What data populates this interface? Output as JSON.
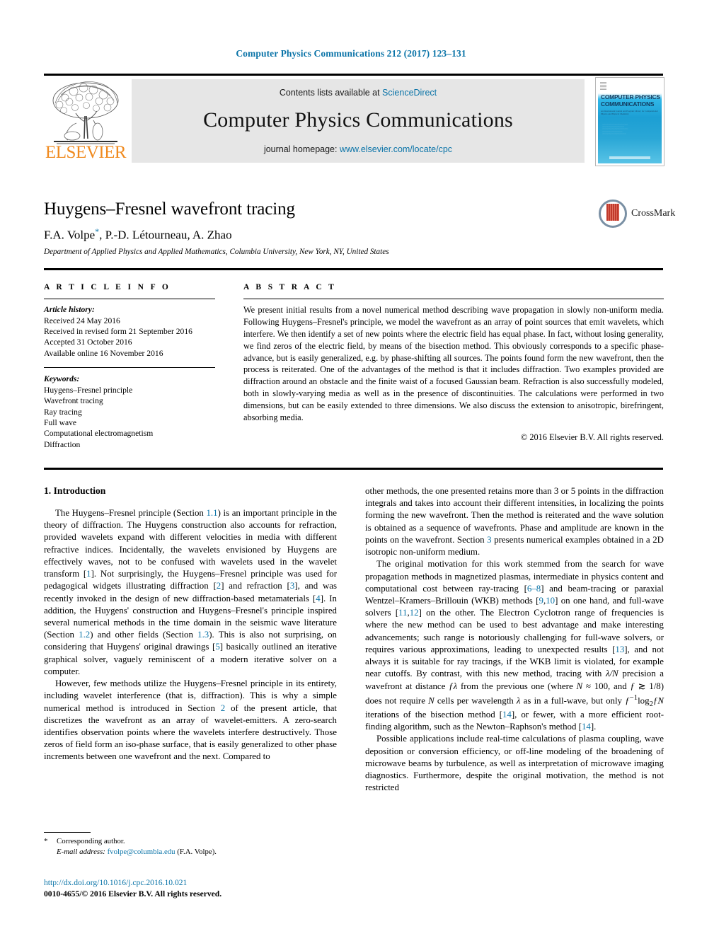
{
  "running_head": "Computer Physics Communications 212 (2017) 123–131",
  "masthead": {
    "contents_prefix": "Contents lists available at ",
    "contents_link": "ScienceDirect",
    "journal_title": "Computer Physics Communications",
    "homepage_prefix": "journal homepage: ",
    "homepage_link": "www.elsevier.com/locate/cpc",
    "publisher_wordmark": "ELSEVIER",
    "publisher_logo_icon": "elsevier-tree-icon"
  },
  "cover": {
    "title_line1": "COMPUTER PHYSICS",
    "title_line2": "COMMUNICATIONS",
    "subtitle": "An International Journal and Program Library for Computational Physics and Physical Chemistry"
  },
  "article": {
    "title": "Huygens–Fresnel wavefront tracing",
    "authors": "F.A. Volpe",
    "authors_rest": ", P.-D. Létourneau, A. Zhao",
    "corresponding_marker": "*",
    "affiliation": "Department of Applied Physics and Applied Mathematics, Columbia University, New York, NY, United States",
    "crossmark_label": "CrossMark",
    "crossmark_icon": "crossmark-icon"
  },
  "info": {
    "label": "A R T I C L E    I N F O",
    "history_heading": "Article history:",
    "history": [
      "Received 24 May 2016",
      "Received in revised form 21 September 2016",
      "Accepted 31 October 2016",
      "Available online 16 November 2016"
    ],
    "keywords_heading": "Keywords:",
    "keywords": [
      "Huygens–Fresnel principle",
      "Wavefront tracing",
      "Ray tracing",
      "Full wave",
      "Computational electromagnetism",
      "Diffraction"
    ]
  },
  "abstract": {
    "label": "A B S T R A C T",
    "text": "We present initial results from a novel numerical method describing wave propagation in slowly non-uniform media. Following Huygens–Fresnel's principle, we model the wavefront as an array of point sources that emit wavelets, which interfere. We then identify a set of new points where the electric field has equal phase. In fact, without losing generality, we find zeros of the electric field, by means of the bisection method. This obviously corresponds to a specific phase-advance, but is easily generalized, e.g. by phase-shifting all sources. The points found form the new wavefront, then the process is reiterated. One of the advantages of the method is that it includes diffraction. Two examples provided are diffraction around an obstacle and the finite waist of a focused Gaussian beam. Refraction is also successfully modeled, both in slowly-varying media as well as in the presence of discontinuities. The calculations were performed in two dimensions, but can be easily extended to three dimensions. We also discuss the extension to anisotropic, birefringent, absorbing media.",
    "copyright": "© 2016 Elsevier B.V. All rights reserved."
  },
  "body": {
    "section_heading": "1. Introduction",
    "left_paragraph_1_a": "The Huygens–Fresnel principle (Section ",
    "left_p1_ref1": "1.1",
    "left_paragraph_1_b": ") is an important principle in the theory of diffraction. The Huygens construction also accounts for refraction, provided wavelets expand with different velocities in media with different refractive indices. Incidentally, the wavelets envisioned by Huygens are effectively waves, not to be confused with wavelets used in the wavelet transform [",
    "left_p1_ref2": "1",
    "left_paragraph_1_c": "]. Not surprisingly, the Huygens–Fresnel principle was used for pedagogical widgets illustrating diffraction [",
    "left_p1_ref3": "2",
    "left_paragraph_1_d": "] and refraction [",
    "left_p1_ref4": "3",
    "left_paragraph_1_e": "], and was recently invoked in the design of new diffraction-based metamaterials [",
    "left_p1_ref5": "4",
    "left_paragraph_1_f": "]. In addition, the Huygens' construction and Huygens–Fresnel's principle inspired several numerical methods in the time domain in the seismic wave literature (Section ",
    "left_p1_ref6": "1.2",
    "left_paragraph_1_g": ") and other fields (Section ",
    "left_p1_ref7": "1.3",
    "left_paragraph_1_h": "). This is also not surprising, on considering that Huygens' original drawings [",
    "left_p1_ref8": "5",
    "left_paragraph_1_i": "] basically outlined an iterative graphical solver, vaguely reminiscent of a modern iterative solver on a computer.",
    "left_paragraph_2_a": "However, few methods utilize the Huygens–Fresnel principle in its entirety, including wavelet interference (that is, diffraction). This is why a simple numerical method is introduced in Section ",
    "left_p2_ref1": "2",
    "left_paragraph_2_b": " of the present article, that discretizes the wavefront as an array of wavelet-emitters. A zero-search identifies observation points where the wavelets interfere destructively. Those zeros of field form an iso-phase surface, that is easily generalized to other phase increments between one wavefront and the next. Compared to",
    "right_paragraph_1_a": "other methods, the one presented retains more than 3 or 5 points in the diffraction integrals and takes into account their different intensities, in localizing the points forming the new wavefront. Then the method is reiterated and the wave solution is obtained as a sequence of wavefronts. Phase and amplitude are known in the points on the wavefront. Section ",
    "right_p1_ref1": "3",
    "right_paragraph_1_b": " presents numerical examples obtained in a 2D isotropic non-uniform medium.",
    "right_paragraph_2_a": "The original motivation for this work stemmed from the search for wave propagation methods in magnetized plasmas, intermediate in physics content and computational cost between ray-tracing [",
    "right_p2_ref1": "6–8",
    "right_paragraph_2_b": "] and beam-tracing or paraxial Wentzel–Kramers–Brillouin (WKB) methods [",
    "right_p2_ref2": "9",
    "right_p2_ref3": "10",
    "right_paragraph_2_c": "] on one hand, and full-wave solvers [",
    "right_p2_ref4": "11",
    "right_p2_ref5": "12",
    "right_paragraph_2_d": "] on the other. The Electron Cyclotron range of frequencies is where the new method can be used to best advantage and make interesting advancements; such range is notoriously challenging for full-wave solvers, or requires various approximations, leading to unexpected results [",
    "right_p2_ref6": "13",
    "right_paragraph_2_e": "], and not always it is suitable for ray tracings, if the WKB limit is violated, for example near cutoffs. By contrast, with this new method, tracing with ",
    "right_math_1": "λ/N",
    "right_paragraph_2_f": " precision a wavefront at distance ",
    "right_math_2": "ƒλ",
    "right_paragraph_2_g": " from the previous one (where ",
    "right_math_3": "N",
    "right_math_3b": " ≈ 100, and ",
    "right_math_4": "ƒ",
    "right_math_4b": " ≳ 1/8) does not require ",
    "right_math_5": "N",
    "right_paragraph_2_h": " cells per wavelength ",
    "right_math_6": "λ",
    "right_paragraph_2_i": " as in a full-wave, but only ",
    "right_math_7": "ƒ",
    "right_math_7sup": "−1",
    "right_math_7b": "log",
    "right_math_7sub": "2",
    "right_math_7c": "ƒN",
    "right_paragraph_2_j": " iterations of the bisection method [",
    "right_p2_ref7": "14",
    "right_paragraph_2_k": "], or fewer, with a more efficient root-finding algorithm, such as the Newton–Raphson's method [",
    "right_p2_ref8": "14",
    "right_paragraph_2_l": "].",
    "right_paragraph_3": "Possible applications include real-time calculations of plasma coupling, wave deposition or conversion efficiency, or off-line modeling of the broadening of microwave beams by turbulence, as well as interpretation of microwave imaging diagnostics. Furthermore, despite the original motivation, the method is not restricted"
  },
  "footnote": {
    "star": "*",
    "corresponding": "Corresponding author.",
    "email_label": "E-mail address:",
    "email": "fvolpe@columbia.edu",
    "email_suffix": "(F.A. Volpe)."
  },
  "footer": {
    "doi": "http://dx.doi.org/10.1016/j.cpc.2016.10.021",
    "issn_line": "0010-4655/© 2016 Elsevier B.V. All rights reserved."
  },
  "colors": {
    "link_blue": "#0b74a8",
    "elsevier_orange": "#f08a1e",
    "band_gray": "#e6e6e6"
  }
}
